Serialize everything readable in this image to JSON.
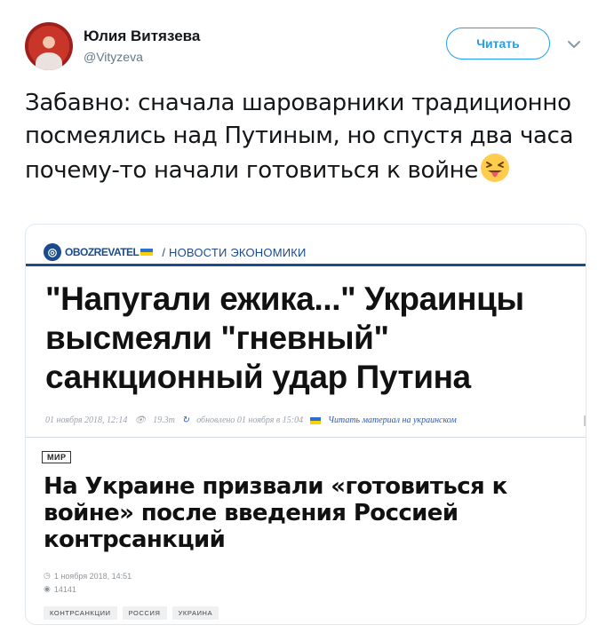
{
  "user": {
    "name": "Юлия Витязева",
    "handle": "@Vityzeva"
  },
  "follow_label": "Читать",
  "tweet": {
    "text": "Забавно: сначала шароварники традиционно посмеялись над Путиным, но спустя два часа почему-то начали готовиться к войне"
  },
  "card": {
    "obozrevatel": {
      "brand": "OBOZREVATEL",
      "section": "/ НОВОСТИ ЭКОНОМИКИ",
      "headline": "\"Напугали ежика...\" Украинцы высмеяли \"гневный\" санкционный удар Путина",
      "date": "01 ноября 2018, 12:14",
      "views": "19.3т",
      "updated": "обновлено 01 ноября в 15:04",
      "ukr_link": "Читать материал на украинском"
    },
    "ria": {
      "section_tag": "МИР",
      "headline": "На Украине призвали «готовиться к войне» после введения Россией контрсанкций",
      "date": "1 ноября 2018, 14:51",
      "views": "14141",
      "tags": [
        "КОНТРСАНКЦИИ",
        "РОССИЯ",
        "УКРАИНА"
      ]
    }
  },
  "colors": {
    "twitter_blue": "#1da1f2",
    "obozrevatel_blue": "#1a4b8e",
    "secondary_text": "#657786"
  },
  "icons": {
    "caret": "chevron-down-icon",
    "emoji": "squinting-face-with-tongue-icon",
    "views": "eye-icon",
    "clock": "clock-icon"
  }
}
